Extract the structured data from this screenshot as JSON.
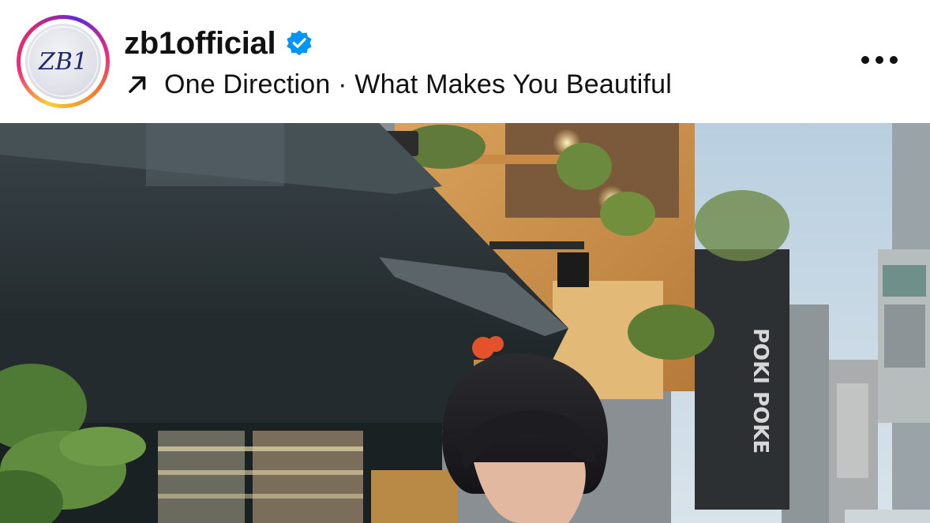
{
  "post": {
    "username": "zb1official",
    "avatar_monogram": "ZB1",
    "verified_icon": "verified-badge-icon",
    "music": {
      "icon": "arrow-up-right-icon",
      "track": "One Direction · What Makes You Beautiful"
    },
    "more_icon": "more-horizontal-icon",
    "photo": {
      "sign_text": "POKI POKE"
    }
  },
  "colors": {
    "verified_blue": "#0095f6",
    "text": "#111111",
    "ring_start": "#f9ce34",
    "ring_mid": "#ee2a7b",
    "ring_end": "#6228d7"
  }
}
